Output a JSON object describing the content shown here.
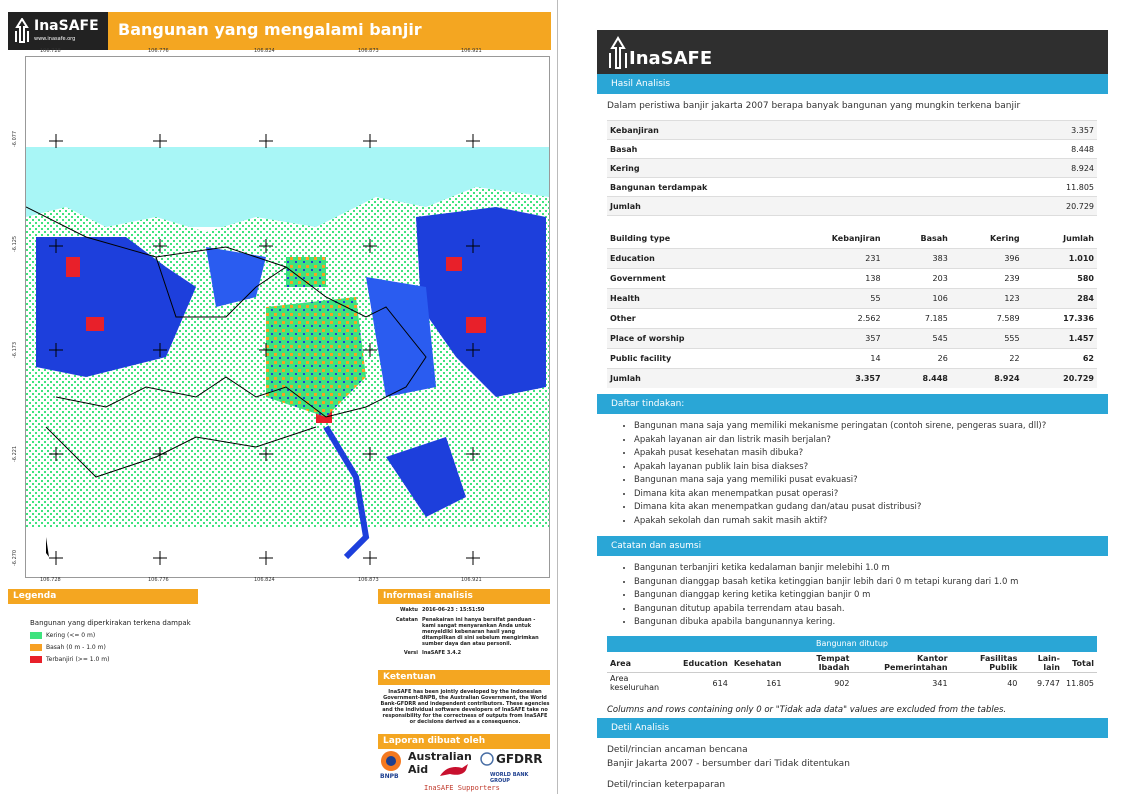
{
  "left_page": {
    "logo_text": "InaSAFE",
    "logo_url": "www.inasafe.org",
    "map_title": "Bangunan yang mengalami banjir",
    "top_ticks": [
      "106.728",
      "106.776",
      "106.824",
      "106.873",
      "106.921"
    ],
    "bottom_ticks": [
      "106.728",
      "106.776",
      "106.824",
      "106.873",
      "106.921"
    ],
    "left_ticks": [
      "-6.077",
      "-6.125",
      "-6.173",
      "-6.221",
      "-6.270"
    ],
    "legend": {
      "header": "Legenda",
      "title": "Bangunan yang diperkirakan terkena dampak",
      "items": [
        {
          "label": "Kering  (<= 0 m)",
          "color": "#3ee37e"
        },
        {
          "label": "Basah  (0 m - 1.0 m)",
          "color": "#f7a023"
        },
        {
          "label": "Terbanjiri  (>= 1.0 m)",
          "color": "#e8202a"
        }
      ]
    },
    "info": {
      "header": "Informasi analisis",
      "waktu_label": "Waktu",
      "waktu_value": "2016-06-23 : 15:51:50",
      "catatan_label": "Catatan",
      "catatan_value": "Penakairan ini hanya bersifat panduan - kami sangat menyarankan Anda untuk menyeldiki kebenaran hasil yang ditampilkan di sini sebelum mengirimkan sumber daya dan atau personil.",
      "versi_label": "Versi",
      "versi_value": "InaSAFE 3.4.2"
    },
    "ketentuan": {
      "header": "Ketentuan",
      "text": "InaSAFE has been jointly developed by the Indonesian Government-BNPB, the Australian Government, the World Bank-GFDRR and independent contributors. These agencies and the individual software developers of InaSAFE take no responsibility for the correctness of outputs from InaSAFE or decisions derived as a consequence."
    },
    "laporan": {
      "header": "Laporan dibuat oleh",
      "bnpb": "BNPB",
      "aus_line1": "Australian",
      "aus_line2": "Aid",
      "gfdrr": "GFDRR",
      "worldbank": "WORLD BANK GROUP",
      "supporters": "InaSAFE Supporters"
    }
  },
  "right_page": {
    "logo_text": "InaSAFE",
    "hasil_header": "Hasil Analisis",
    "question": "Dalam peristiwa banjir jakarta 2007 berapa banyak bangunan yang mungkin terkena banjir",
    "summary": [
      {
        "label": "Kebanjiran",
        "value": "3.357"
      },
      {
        "label": "Basah",
        "value": "8.448"
      },
      {
        "label": "Kering",
        "value": "8.924"
      },
      {
        "label": "Bangunan terdampak",
        "value": "11.805"
      },
      {
        "label": "Jumlah",
        "value": "20.729"
      }
    ],
    "building_table": {
      "headers": [
        "Building type",
        "Kebanjiran",
        "Basah",
        "Kering",
        "Jumlah"
      ],
      "rows": [
        [
          "Education",
          "231",
          "383",
          "396",
          "1.010"
        ],
        [
          "Government",
          "138",
          "203",
          "239",
          "580"
        ],
        [
          "Health",
          "55",
          "106",
          "123",
          "284"
        ],
        [
          "Other",
          "2.562",
          "7.185",
          "7.589",
          "17.336"
        ],
        [
          "Place of worship",
          "357",
          "545",
          "555",
          "1.457"
        ],
        [
          "Public facility",
          "14",
          "26",
          "22",
          "62"
        ],
        [
          "Jumlah",
          "3.357",
          "8.448",
          "8.924",
          "20.729"
        ]
      ]
    },
    "daftar_header": "Daftar tindakan:",
    "daftar_items": [
      "Bangunan mana saja yang memiliki mekanisme peringatan (contoh sirene, pengeras suara, dll)?",
      "Apakah layanan air dan listrik masih berjalan?",
      "Apakah pusat kesehatan masih dibuka?",
      "Apakah layanan publik lain bisa diakses?",
      "Bangunan mana saja yang memiliki pusat evakuasi?",
      "Dimana kita akan menempatkan pusat operasi?",
      "Dimana kita akan menempatkan gudang dan/atau pusat distribusi?",
      "Apakah sekolah dan rumah sakit masih aktif?"
    ],
    "catatan_header": "Catatan dan asumsi",
    "catatan_items": [
      "Bangunan terbanjiri ketika kedalaman banjir melebihi 1.0 m",
      "Bangunan dianggap basah ketika ketinggian banjir lebih dari 0 m tetapi kurang dari 1.0 m",
      "Bangunan dianggap kering ketika ketinggian banjir 0 m",
      "Bangunan ditutup apabila terrendam atau basah.",
      "Bangunan dibuka apabila bangunannya kering."
    ],
    "closed_header": "Bangunan ditutup",
    "closed_table": {
      "headers": [
        "Area",
        "Education",
        "Kesehatan",
        "Tempat Ibadah",
        "Kantor Pemerintahan",
        "Fasilitas Publik",
        "Lain-lain",
        "Total"
      ],
      "row": [
        "Area keseluruhan",
        "614",
        "161",
        "902",
        "341",
        "40",
        "9.747",
        "11.805"
      ]
    },
    "note": "Columns and rows containing only 0 or \"Tidak ada data\" values are excluded from the tables.",
    "detil_header": "Detil Analisis",
    "detil_line1": "Detil/rincian ancaman bencana",
    "detil_line2": "Banjir Jakarta 2007 - bersumber dari Tidak ditentukan",
    "detil_line3": "Detil/rincian keterpaparan"
  }
}
